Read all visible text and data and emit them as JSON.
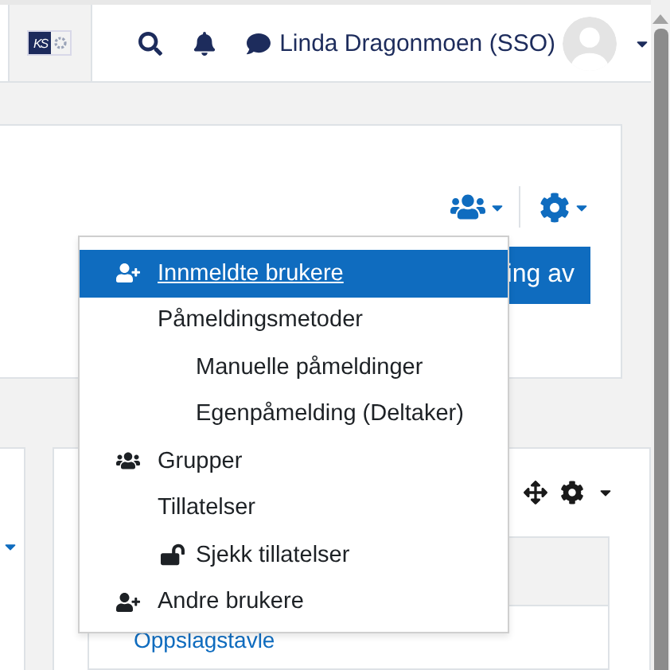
{
  "navbar": {
    "logo_text": "KS",
    "user_name": "Linda Dragonmoen (SSO)"
  },
  "course_header": {
    "button_label": "ing av"
  },
  "participants_menu": {
    "items": [
      {
        "label": "Innmeldte brukere",
        "kind": "adduser",
        "selected": true
      },
      {
        "label": "Påmeldingsmetoder",
        "kind": "text",
        "selected": false,
        "children": [
          {
            "label": "Manuelle påmeldinger",
            "kind": "text",
            "selected": false
          },
          {
            "label": "Egenpåmelding (Deltaker)",
            "kind": "text",
            "selected": false
          }
        ]
      },
      {
        "label": "Grupper",
        "kind": "group",
        "selected": false
      },
      {
        "label": "Tillatelser",
        "kind": "text",
        "selected": false,
        "children": [
          {
            "label": "Sjekk tillatelser",
            "kind": "unlock",
            "selected": false
          }
        ]
      },
      {
        "label": "Andre brukere",
        "kind": "adduser",
        "selected": false
      }
    ]
  },
  "block": {
    "link": "Oppslagstavle"
  }
}
